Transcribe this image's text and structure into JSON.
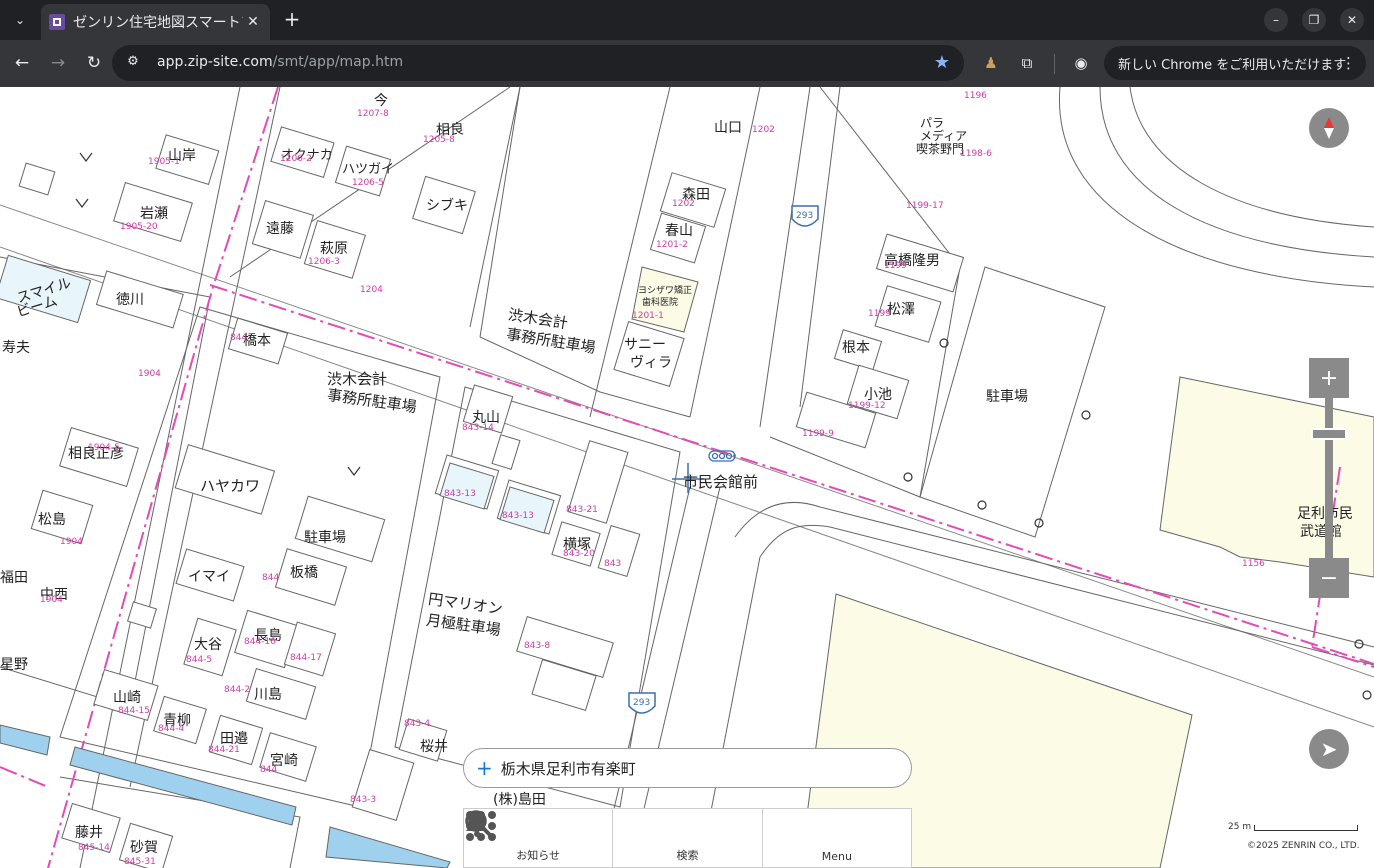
{
  "browser": {
    "tab_title": "ゼンリン住宅地図スマートフォン",
    "url_host": "app.zip-site.com",
    "url_path": "/smt/app/map.htm",
    "update_text": "新しい Chrome をご利用いただけます",
    "icons": {
      "tab_list": "chevron-down-icon",
      "close": "close-icon",
      "new_tab": "plus-icon",
      "back": "arrow-left-icon",
      "forward": "arrow-right-icon",
      "reload": "reload-icon",
      "site_info": "tune-icon",
      "bookmark": "star-icon",
      "extension": "puzzle-icon",
      "profile": "account-icon",
      "more": "kebab-menu-icon"
    }
  },
  "map": {
    "labels": [
      {
        "text": "今",
        "size": 14
      },
      {
        "text": "相良",
        "size": 14
      },
      {
        "text": "山口",
        "size": 14
      },
      {
        "text": "オクナカ",
        "size": 13
      },
      {
        "text": "ハツガイ",
        "size": 13
      },
      {
        "text": "山岸",
        "size": 14
      },
      {
        "text": "岩瀬",
        "size": 14
      },
      {
        "text": "森田",
        "size": 14
      },
      {
        "text": "春山",
        "size": 14
      },
      {
        "text": "シブキ",
        "size": 14
      },
      {
        "text": "遠藤",
        "size": 14
      },
      {
        "text": "萩原",
        "size": 14
      },
      {
        "text": "高橋隆男",
        "size": 14
      },
      {
        "text": "松澤",
        "size": 14
      },
      {
        "text": "根本",
        "size": 14
      },
      {
        "text": "小池",
        "size": 14
      },
      {
        "text": "駐車場",
        "size": 14
      },
      {
        "text": "スマイル",
        "size": 14
      },
      {
        "text": "ビーム",
        "size": 14
      },
      {
        "text": "徳川",
        "size": 14
      },
      {
        "text": "寿夫",
        "size": 14
      },
      {
        "text": "橋本",
        "size": 14
      },
      {
        "text": "渋木会計",
        "size": 15
      },
      {
        "text": "事務所駐車場",
        "size": 15
      },
      {
        "text": "渋木会計",
        "size": 15
      },
      {
        "text": "事務所駐車場",
        "size": 15
      },
      {
        "text": "サニー",
        "size": 14
      },
      {
        "text": "ヴィラ",
        "size": 14
      },
      {
        "text": "丸山",
        "size": 14
      },
      {
        "text": "市民会館前",
        "size": 15
      },
      {
        "text": "相良正彦",
        "size": 14
      },
      {
        "text": "ハヤカワ",
        "size": 15
      },
      {
        "text": "松島",
        "size": 14
      },
      {
        "text": "駐車場",
        "size": 14
      },
      {
        "text": "横塚",
        "size": 14
      },
      {
        "text": "イマイ",
        "size": 14
      },
      {
        "text": "板橋",
        "size": 14
      },
      {
        "text": "中西",
        "size": 14
      },
      {
        "text": "星野",
        "size": 14
      },
      {
        "text": "大谷",
        "size": 14
      },
      {
        "text": "長島",
        "size": 14
      },
      {
        "text": "円マリオン",
        "size": 15
      },
      {
        "text": "月極駐車場",
        "size": 15
      },
      {
        "text": "山崎",
        "size": 14
      },
      {
        "text": "青柳",
        "size": 14
      },
      {
        "text": "川島",
        "size": 14
      },
      {
        "text": "田邉",
        "size": 14
      },
      {
        "text": "宮崎",
        "size": 14
      },
      {
        "text": "桜井",
        "size": 14
      },
      {
        "text": "(株)島田",
        "size": 14
      },
      {
        "text": "藤井",
        "size": 14
      },
      {
        "text": "砂賀",
        "size": 14
      },
      {
        "text": "パラ",
        "size": 12
      },
      {
        "text": "メディア",
        "size": 12
      },
      {
        "text": "喫茶野門",
        "size": 12
      },
      {
        "text": "足利市民",
        "size": 14
      },
      {
        "text": "武道館",
        "size": 14
      },
      {
        "text": "ヨシザワ矯正",
        "size": 9
      },
      {
        "text": "歯科医院",
        "size": 9
      },
      {
        "text": "福田",
        "size": 14
      }
    ],
    "lot_numbers": [
      "1207-8",
      "1205-8",
      "1202",
      "1206-2",
      "1206-5",
      "1905-1",
      "1905-20",
      "1202",
      "1201-2",
      "1201-1",
      "1206-3",
      "1204",
      "1199-17",
      "1199",
      "1199",
      "1198-6",
      "1199-12",
      "1199-9",
      "1904",
      "844",
      "1904",
      "1904-5",
      "1904",
      "843-14",
      "843-13",
      "843-13",
      "843-21",
      "843-20",
      "843",
      "844",
      "844-16",
      "844-17",
      "844-5",
      "844-2",
      "844-15",
      "844-4",
      "844-21",
      "844",
      "843-4",
      "843-8",
      "843-3",
      "845-14",
      "845-31",
      "1156",
      "1196"
    ],
    "route_shield": "293",
    "search_text": "栃木県足利市有楽町",
    "controls": {
      "compass": "compass-icon",
      "zoom_in": "+",
      "zoom_out": "−",
      "locate": "navigation-arrow-icon"
    },
    "bottom_nav": [
      {
        "label": "お知らせ",
        "icon": "bell-icon"
      },
      {
        "label": "検索",
        "icon": "search-icon"
      },
      {
        "label": "Menu",
        "icon": "grid-dots-icon"
      }
    ],
    "scale_label": "25 m",
    "copyright": "©2025 ZENRIN CO., LTD."
  }
}
